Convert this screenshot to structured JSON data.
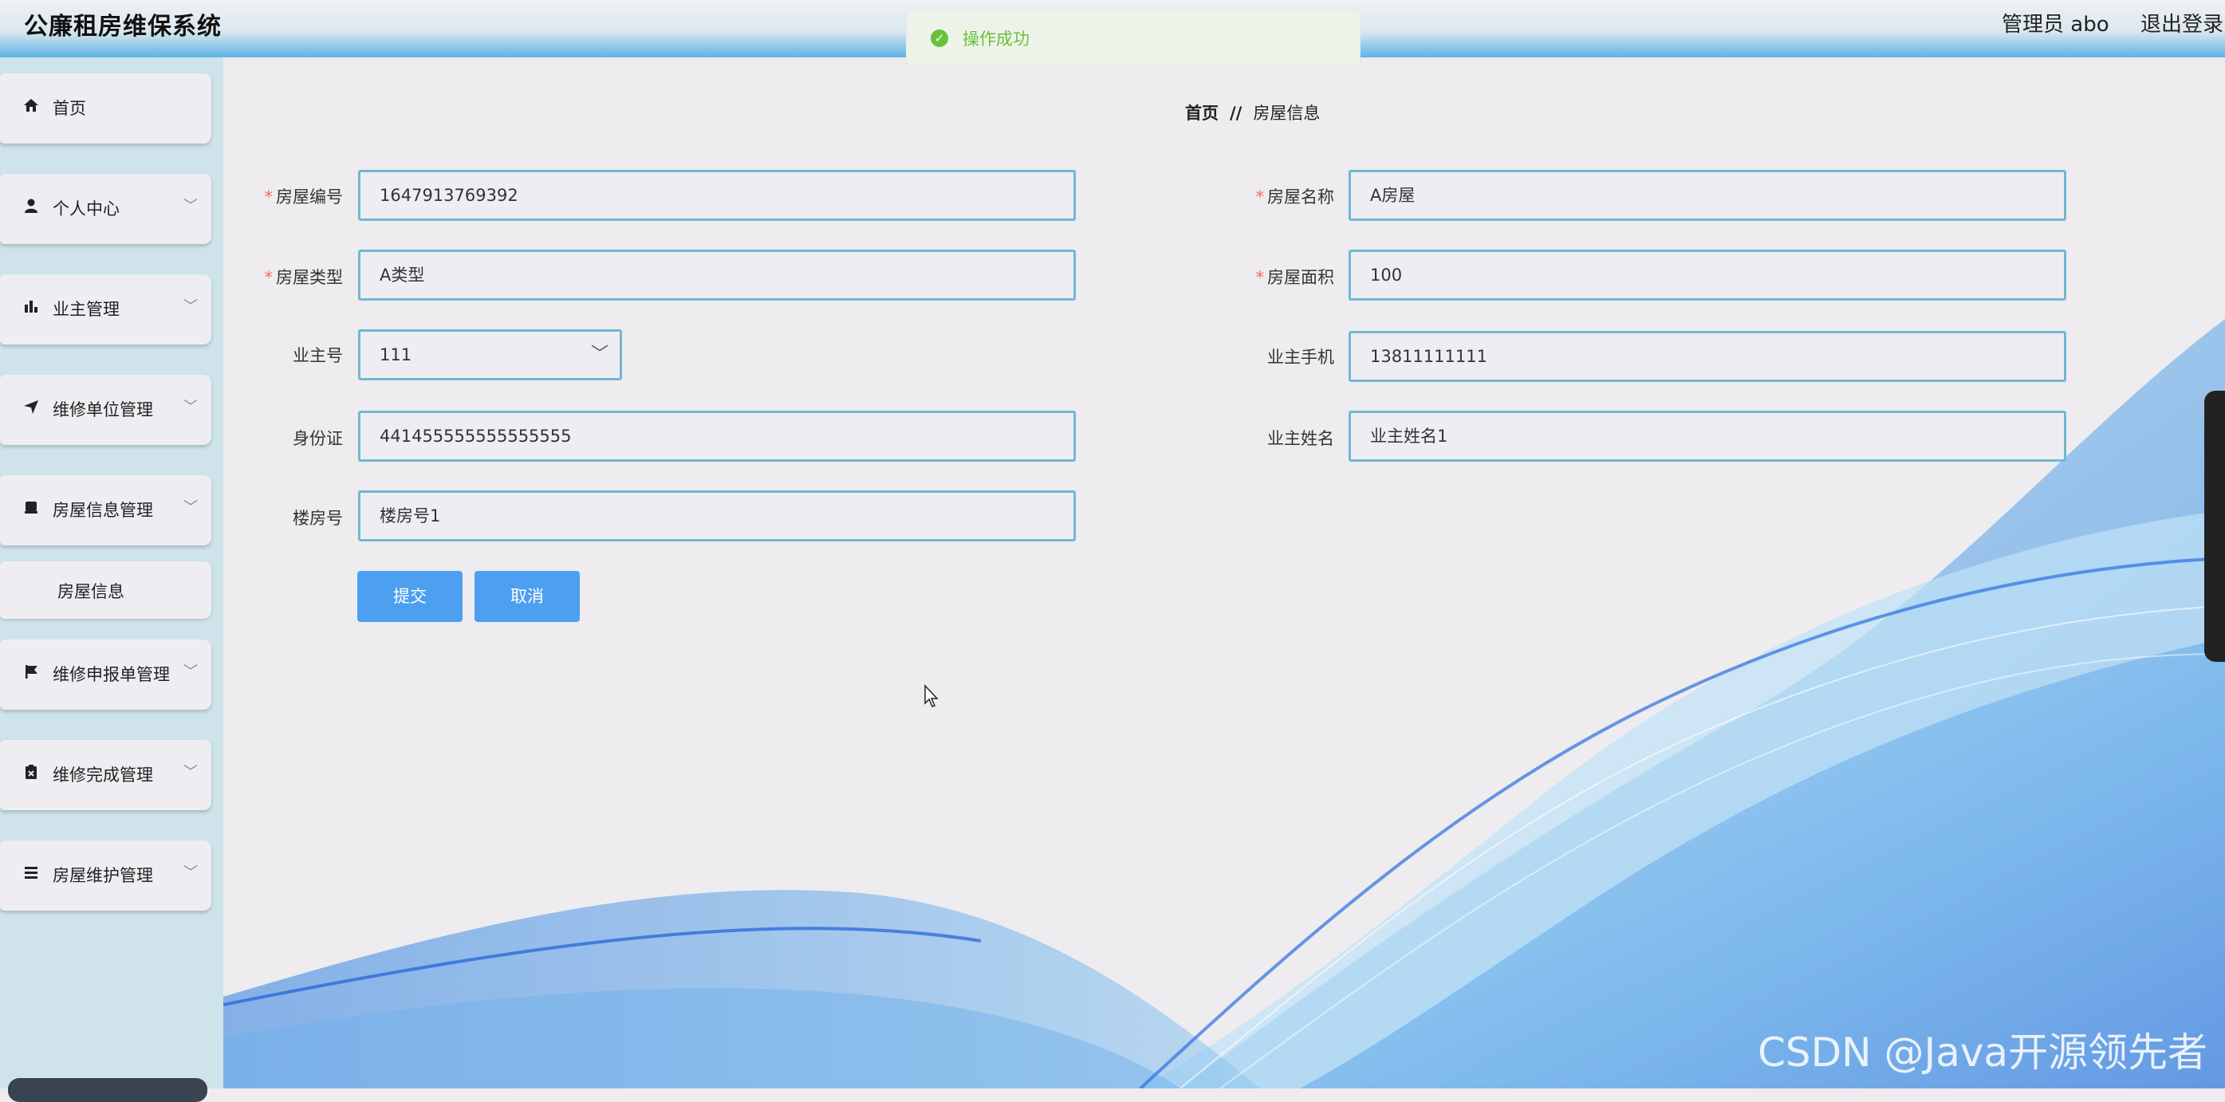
{
  "header": {
    "app_title": "公廉租房维保系统",
    "user_label": "管理员 abo",
    "logout_label": "退出登录"
  },
  "toast": {
    "message": "操作成功",
    "icon": "check-circle-icon"
  },
  "sidebar": {
    "items": [
      {
        "label": "首页",
        "icon": "home-icon"
      },
      {
        "label": "个人中心",
        "icon": "user-icon"
      },
      {
        "label": "业主管理",
        "icon": "bar-chart-icon"
      },
      {
        "label": "维修单位管理",
        "icon": "send-icon"
      },
      {
        "label": "房屋信息管理",
        "icon": "box-icon"
      },
      {
        "label": "维修申报单管理",
        "icon": "flag-icon"
      },
      {
        "label": "维修完成管理",
        "icon": "clipboard-icon"
      },
      {
        "label": "房屋维护管理",
        "icon": "list-icon"
      }
    ],
    "subitem": {
      "label": "房屋信息"
    }
  },
  "breadcrumb": {
    "home": "首页",
    "separator": "//",
    "current": "房屋信息"
  },
  "form": {
    "house_no": {
      "label": "房屋编号",
      "value": "1647913769392"
    },
    "house_name": {
      "label": "房屋名称",
      "value": "A房屋"
    },
    "house_type": {
      "label": "房屋类型",
      "value": "A类型"
    },
    "house_area": {
      "label": "房屋面积",
      "value": "100"
    },
    "owner_no": {
      "label": "业主号",
      "value": "111"
    },
    "owner_phone": {
      "label": "业主手机",
      "value": "13811111111"
    },
    "id_card": {
      "label": "身份证",
      "value": "441455555555555555"
    },
    "owner_name": {
      "label": "业主姓名",
      "value": "业主姓名1"
    },
    "building_no": {
      "label": "楼房号",
      "value": "楼房号1"
    },
    "submit_label": "提交",
    "cancel_label": "取消"
  },
  "watermark": "CSDN @Java开源领先者",
  "colors": {
    "accent": "#4d9ff0",
    "field_border": "#72b6d3",
    "success": "#67c23a",
    "required": "#f56c6c",
    "sidebar_bg": "#cfe4ea"
  }
}
